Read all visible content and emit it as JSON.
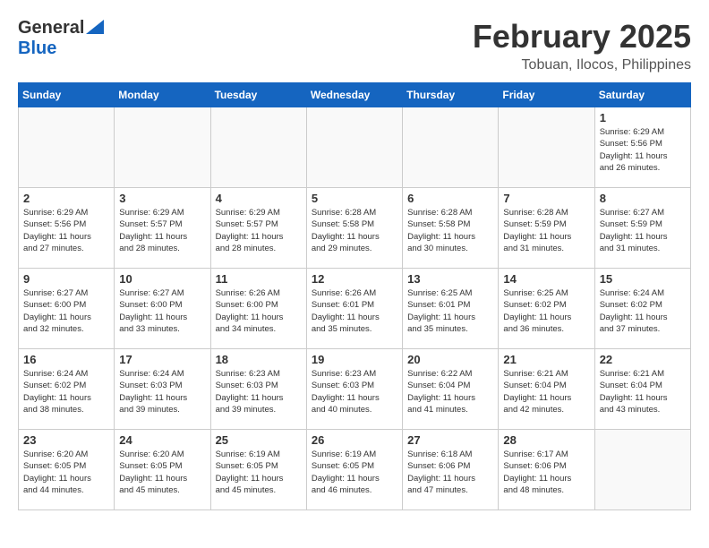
{
  "header": {
    "logo_general": "General",
    "logo_blue": "Blue",
    "month_title": "February 2025",
    "location": "Tobuan, Ilocos, Philippines"
  },
  "days_of_week": [
    "Sunday",
    "Monday",
    "Tuesday",
    "Wednesday",
    "Thursday",
    "Friday",
    "Saturday"
  ],
  "weeks": [
    [
      {
        "day": "",
        "info": ""
      },
      {
        "day": "",
        "info": ""
      },
      {
        "day": "",
        "info": ""
      },
      {
        "day": "",
        "info": ""
      },
      {
        "day": "",
        "info": ""
      },
      {
        "day": "",
        "info": ""
      },
      {
        "day": "1",
        "info": "Sunrise: 6:29 AM\nSunset: 5:56 PM\nDaylight: 11 hours\nand 26 minutes."
      }
    ],
    [
      {
        "day": "2",
        "info": "Sunrise: 6:29 AM\nSunset: 5:56 PM\nDaylight: 11 hours\nand 27 minutes."
      },
      {
        "day": "3",
        "info": "Sunrise: 6:29 AM\nSunset: 5:57 PM\nDaylight: 11 hours\nand 28 minutes."
      },
      {
        "day": "4",
        "info": "Sunrise: 6:29 AM\nSunset: 5:57 PM\nDaylight: 11 hours\nand 28 minutes."
      },
      {
        "day": "5",
        "info": "Sunrise: 6:28 AM\nSunset: 5:58 PM\nDaylight: 11 hours\nand 29 minutes."
      },
      {
        "day": "6",
        "info": "Sunrise: 6:28 AM\nSunset: 5:58 PM\nDaylight: 11 hours\nand 30 minutes."
      },
      {
        "day": "7",
        "info": "Sunrise: 6:28 AM\nSunset: 5:59 PM\nDaylight: 11 hours\nand 31 minutes."
      },
      {
        "day": "8",
        "info": "Sunrise: 6:27 AM\nSunset: 5:59 PM\nDaylight: 11 hours\nand 31 minutes."
      }
    ],
    [
      {
        "day": "9",
        "info": "Sunrise: 6:27 AM\nSunset: 6:00 PM\nDaylight: 11 hours\nand 32 minutes."
      },
      {
        "day": "10",
        "info": "Sunrise: 6:27 AM\nSunset: 6:00 PM\nDaylight: 11 hours\nand 33 minutes."
      },
      {
        "day": "11",
        "info": "Sunrise: 6:26 AM\nSunset: 6:00 PM\nDaylight: 11 hours\nand 34 minutes."
      },
      {
        "day": "12",
        "info": "Sunrise: 6:26 AM\nSunset: 6:01 PM\nDaylight: 11 hours\nand 35 minutes."
      },
      {
        "day": "13",
        "info": "Sunrise: 6:25 AM\nSunset: 6:01 PM\nDaylight: 11 hours\nand 35 minutes."
      },
      {
        "day": "14",
        "info": "Sunrise: 6:25 AM\nSunset: 6:02 PM\nDaylight: 11 hours\nand 36 minutes."
      },
      {
        "day": "15",
        "info": "Sunrise: 6:24 AM\nSunset: 6:02 PM\nDaylight: 11 hours\nand 37 minutes."
      }
    ],
    [
      {
        "day": "16",
        "info": "Sunrise: 6:24 AM\nSunset: 6:02 PM\nDaylight: 11 hours\nand 38 minutes."
      },
      {
        "day": "17",
        "info": "Sunrise: 6:24 AM\nSunset: 6:03 PM\nDaylight: 11 hours\nand 39 minutes."
      },
      {
        "day": "18",
        "info": "Sunrise: 6:23 AM\nSunset: 6:03 PM\nDaylight: 11 hours\nand 39 minutes."
      },
      {
        "day": "19",
        "info": "Sunrise: 6:23 AM\nSunset: 6:03 PM\nDaylight: 11 hours\nand 40 minutes."
      },
      {
        "day": "20",
        "info": "Sunrise: 6:22 AM\nSunset: 6:04 PM\nDaylight: 11 hours\nand 41 minutes."
      },
      {
        "day": "21",
        "info": "Sunrise: 6:21 AM\nSunset: 6:04 PM\nDaylight: 11 hours\nand 42 minutes."
      },
      {
        "day": "22",
        "info": "Sunrise: 6:21 AM\nSunset: 6:04 PM\nDaylight: 11 hours\nand 43 minutes."
      }
    ],
    [
      {
        "day": "23",
        "info": "Sunrise: 6:20 AM\nSunset: 6:05 PM\nDaylight: 11 hours\nand 44 minutes."
      },
      {
        "day": "24",
        "info": "Sunrise: 6:20 AM\nSunset: 6:05 PM\nDaylight: 11 hours\nand 45 minutes."
      },
      {
        "day": "25",
        "info": "Sunrise: 6:19 AM\nSunset: 6:05 PM\nDaylight: 11 hours\nand 45 minutes."
      },
      {
        "day": "26",
        "info": "Sunrise: 6:19 AM\nSunset: 6:05 PM\nDaylight: 11 hours\nand 46 minutes."
      },
      {
        "day": "27",
        "info": "Sunrise: 6:18 AM\nSunset: 6:06 PM\nDaylight: 11 hours\nand 47 minutes."
      },
      {
        "day": "28",
        "info": "Sunrise: 6:17 AM\nSunset: 6:06 PM\nDaylight: 11 hours\nand 48 minutes."
      },
      {
        "day": "",
        "info": ""
      }
    ]
  ]
}
